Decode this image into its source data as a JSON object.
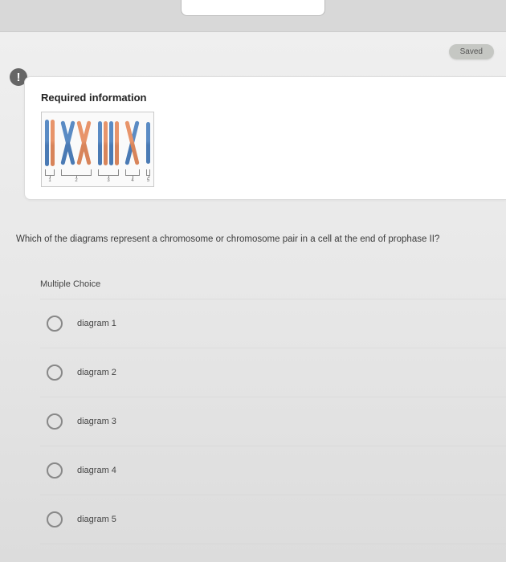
{
  "header": {
    "saved_label": "Saved"
  },
  "info": {
    "icon_glyph": "!",
    "title": "Required information",
    "diagram_labels": [
      "1",
      "2",
      "3",
      "4",
      "5"
    ]
  },
  "question": {
    "text": "Which of the diagrams represent a chromosome or chromosome pair in a cell at the end of prophase II?"
  },
  "mc": {
    "header": "Multiple Choice",
    "options": [
      {
        "label": "diagram 1"
      },
      {
        "label": "diagram 2"
      },
      {
        "label": "diagram 3"
      },
      {
        "label": "diagram 4"
      },
      {
        "label": "diagram 5"
      }
    ]
  }
}
